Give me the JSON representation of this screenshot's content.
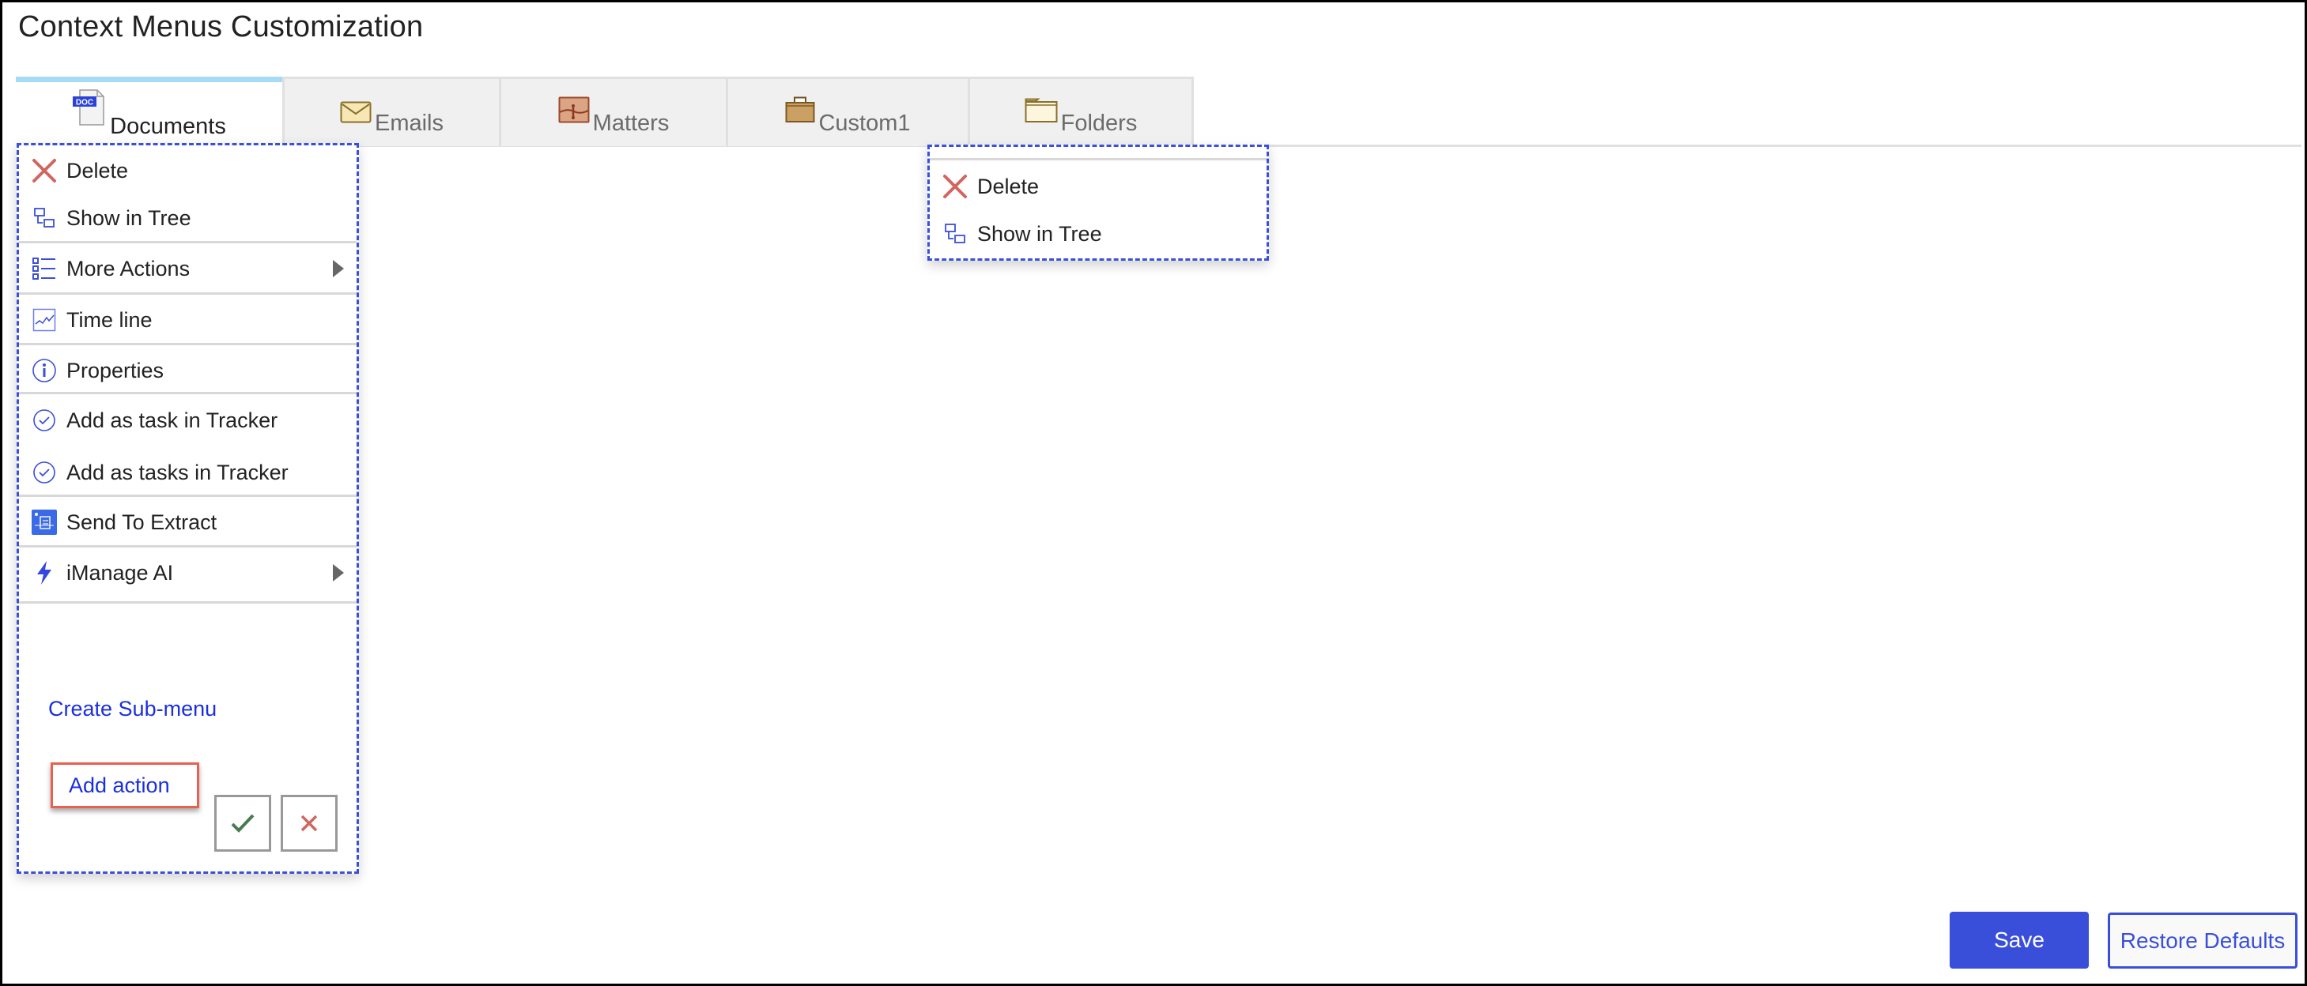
{
  "page": {
    "title": "Context Menus Customization"
  },
  "tabs": [
    {
      "label": "Documents",
      "icon": "doc-file-icon",
      "active": true,
      "icon_text": "DOC"
    },
    {
      "label": "Emails",
      "icon": "envelope-icon",
      "active": false
    },
    {
      "label": "Matters",
      "icon": "matter-icon",
      "active": false
    },
    {
      "label": "Custom1",
      "icon": "briefcase-icon",
      "active": false
    },
    {
      "label": "Folders",
      "icon": "folder-icon",
      "active": false
    }
  ],
  "left_menu": {
    "items": [
      {
        "label": "Delete",
        "icon": "delete-x-icon"
      },
      {
        "label": "Show in Tree",
        "icon": "show-in-tree-icon"
      },
      {
        "label": "More Actions",
        "icon": "list-icon",
        "submenu": true
      },
      {
        "label": "Time line",
        "icon": "timeline-chart-icon"
      },
      {
        "label": "Properties",
        "icon": "info-icon"
      },
      {
        "label": "Add as task in Tracker",
        "icon": "check-circle-icon"
      },
      {
        "label": "Add as tasks in Tracker",
        "icon": "check-circle-icon"
      },
      {
        "label": "Send To Extract",
        "icon": "extract-icon"
      },
      {
        "label": "iManage AI",
        "icon": "lightning-icon",
        "submenu": true
      }
    ],
    "add_action_label": "Add action",
    "create_submenu_label": "Create Sub-menu",
    "confirm_icon": "checkmark-icon",
    "cancel_icon": "close-icon"
  },
  "right_menu": {
    "items": [
      {
        "label": "Delete",
        "icon": "delete-x-icon"
      },
      {
        "label": "Show in Tree",
        "icon": "show-in-tree-icon"
      }
    ]
  },
  "footer": {
    "save_label": "Save",
    "restore_label": "Restore Defaults"
  },
  "colors": {
    "accent": "#3a4fd9",
    "active_tab_bar": "#a5dbf7",
    "delete_red": "#d0665f",
    "highlight_box": "#e8604f",
    "link_blue": "#1a2fe0",
    "confirm_green": "#4a7a52"
  }
}
